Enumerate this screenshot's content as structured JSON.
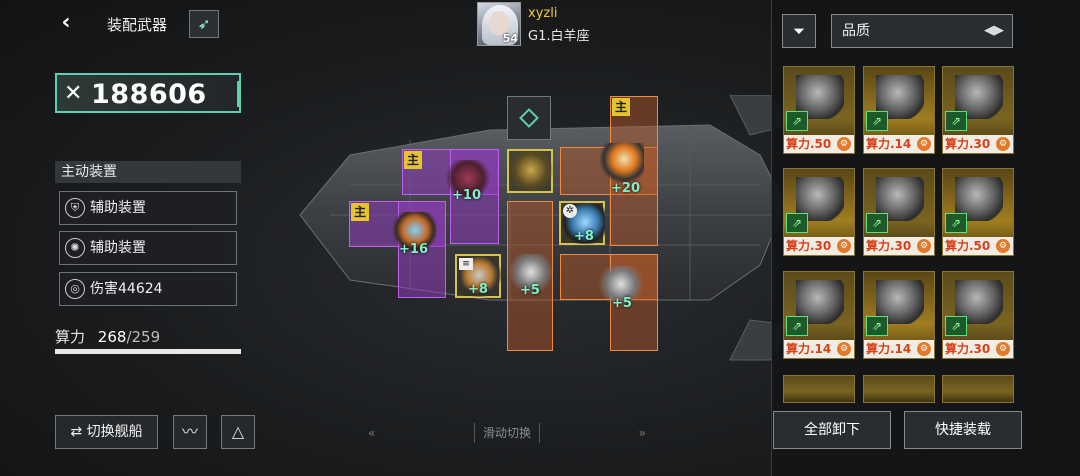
{
  "header": {
    "back_icon": "chevron-left-icon",
    "title": "装配武器",
    "rocket_icon": "rocket-icon"
  },
  "pilot": {
    "name": "xyzli",
    "level": "54",
    "rank": "G1.白羊座"
  },
  "combat_power": "188606",
  "active_equipment": {
    "header": "主动装置",
    "slots": [
      {
        "icon": "shield-emblem-icon",
        "label": "辅助装置"
      },
      {
        "icon": "gear-ring-icon",
        "label": "辅助装置"
      },
      {
        "icon": "orb-ring-icon",
        "label": "伤害44624"
      }
    ]
  },
  "capacity": {
    "label": "算力",
    "used": "268",
    "separator": "/",
    "total": "259",
    "fill_percent": 100
  },
  "bottom_left": {
    "switch_ship": "切换舰船",
    "switch_icon": "swap-arrows-icon",
    "btn2_icon": "signal-wave-icon",
    "btn3_icon": "triangle-emblem-icon"
  },
  "swipe": {
    "left": "«",
    "label": "滑动切换",
    "right": "»"
  },
  "ship_slots": {
    "tag_main": "主",
    "bonuses": [
      "+10",
      "+16",
      "+20",
      "+8",
      "+8",
      "+5",
      "+5"
    ]
  },
  "inventory": {
    "filter_icon": "filter-list-icon",
    "sort_label": "品质",
    "sort_icon": "sort-toggle-icon",
    "items": [
      {
        "label": "算力.50"
      },
      {
        "label": "算力.14"
      },
      {
        "label": "算力.30"
      },
      {
        "label": "算力.30"
      },
      {
        "label": "算力.30"
      },
      {
        "label": "算力.50"
      },
      {
        "label": "算力.14"
      },
      {
        "label": "算力.14"
      },
      {
        "label": "算力.30"
      }
    ],
    "unequip_all": "全部卸下",
    "quick_equip": "快捷装载"
  }
}
